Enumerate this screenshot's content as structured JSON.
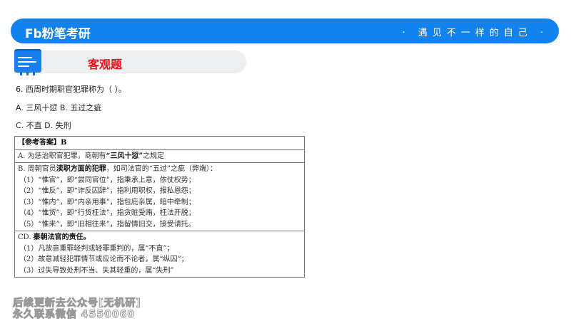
{
  "header": {
    "logo": "Fb粉笔考研",
    "slogan": "· 遇见不一样的自己 ·"
  },
  "section": {
    "title": "客观题"
  },
  "question": {
    "stem": "6. 西周时期职官犯罪称为（ ）。",
    "options_line1": "A. 三风十愆  B. 五过之疵",
    "options_line2": "C. 不直  D. 失刑"
  },
  "answer": {
    "heading": "【参考答案】B",
    "a_prefix": "A. 为惩治职官犯罪，商朝有",
    "a_bold": "“三风十愆”",
    "a_suffix": "之规定",
    "b_prefix": "B. 周朝官员",
    "b_bold": "渎职方面的犯罪",
    "b_suffix": "，如司法官的“五过”之疵（弊端）：",
    "b_items": [
      "（1）“惟官”，即“尝同官位”，指秉承上意，依仗权势；",
      "（2）“惟反”，即“诈反囚辞”，指利用职权，报私恩怨；",
      "（3）“惟内”，即“内亲用事”，指包庇亲属，暗中牵制；",
      "（4）“惟货”，即“行货枉法”，指贪赃受贿，枉法开脱；",
      "（5）“惟来”，即“旧相往来”，指留情旧交，接受请托。"
    ],
    "cd_prefix": "CD. ",
    "cd_bold": "秦朝法官的责任。",
    "cd_items": [
      "（1）凡故意重罪轻判或轻罪重判的，属“不直”；",
      "（2）故意减轻犯罪情节或应论而不论者，属“纵囚”；",
      "（3）过失导致处刑不当、失其轻重的，属“失刑”"
    ]
  },
  "watermark": {
    "line1": "后续更新去公众号[无机研]",
    "line2": "永久联系微信 4550060"
  }
}
